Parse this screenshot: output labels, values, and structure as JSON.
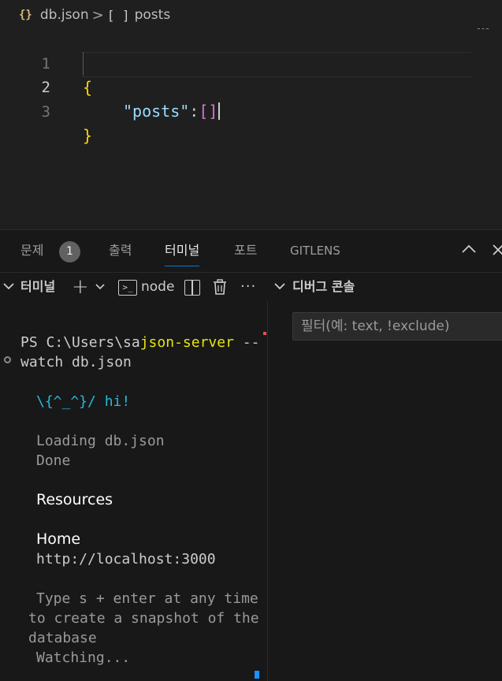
{
  "breadcrumb": {
    "json_icon": "{}",
    "file": "db.json",
    "separator": ">",
    "symbol_icon": "[ ]",
    "symbol": "posts"
  },
  "editor": {
    "lines": [
      {
        "number": "1",
        "text": "{"
      },
      {
        "number": "2",
        "key": "\"posts\"",
        "colon": ":",
        "value": "[]"
      },
      {
        "number": "3",
        "text": "}"
      }
    ]
  },
  "panel": {
    "tabs": [
      {
        "label": "문제",
        "badge": "1"
      },
      {
        "label": "출력"
      },
      {
        "label": "터미널",
        "active": true
      },
      {
        "label": "포트"
      },
      {
        "label": "GITLENS"
      }
    ],
    "controls": {
      "maximize_icon": "chevron-up-icon",
      "close_icon": "close-icon"
    }
  },
  "toolbar": {
    "terminal_label": "터미널",
    "add_icon": "+",
    "dropdown_icon": "chevron-down-icon",
    "terminal_icon_glyph": ">_",
    "shell_name": "node",
    "more_icon": "···",
    "debug_label": "디버그 콘솔"
  },
  "terminal": {
    "prompt_prefix": "PS C:\\Users\\sa",
    "command": "json-server",
    "command_rest": " --",
    "line2": "watch db.json",
    "hi": "\\{^_^}/ hi!",
    "loading": "Loading db.json",
    "done": "Done",
    "resources": "Resources",
    "home": "Home",
    "url": "http://localhost:3000",
    "hint1": "Type s + enter at any time",
    "hint2": "to create a snapshot of the",
    "hint3": "database",
    "watching": "Watching..."
  },
  "debug_console": {
    "filter_placeholder": "필터(예: text, !exclude)"
  },
  "colors": {
    "accent": "#0078d4",
    "json_key": "#9cdcfe",
    "brace": "#ffd700",
    "bracket": "#da70d6",
    "terminal_cyan": "#29b8db",
    "terminal_yellow": "#e5e510"
  }
}
